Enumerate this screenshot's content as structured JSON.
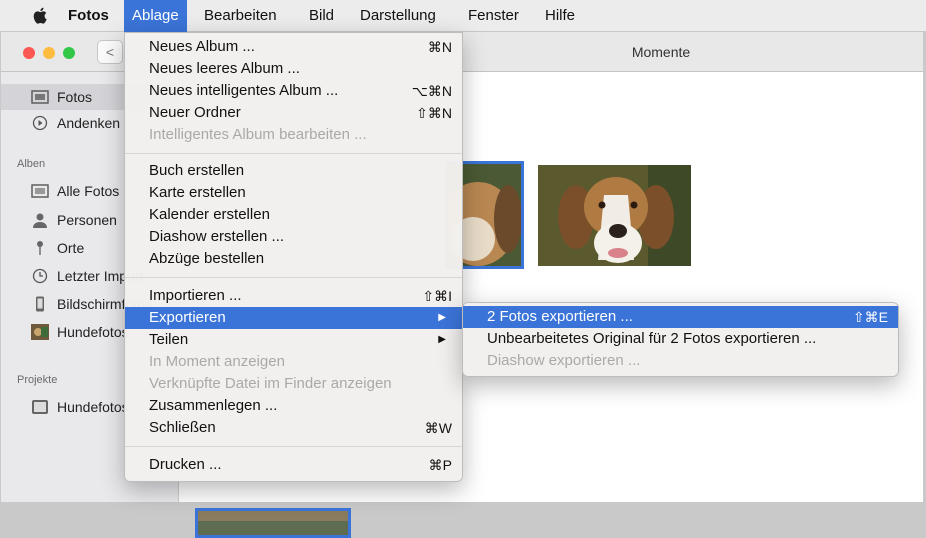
{
  "menubar": {
    "app": "Fotos",
    "items": [
      "Ablage",
      "Bearbeiten",
      "Bild",
      "Darstellung",
      "Fenster",
      "Hilfe"
    ]
  },
  "window": {
    "title": "Momente",
    "back": "<"
  },
  "sidebar": {
    "top": [
      "Fotos",
      "Andenken"
    ],
    "albums_header": "Alben",
    "albums": [
      "Alle Fotos",
      "Personen",
      "Orte",
      "Letzter Import",
      "Bildschirmfotos",
      "Hundefotos"
    ],
    "projects_header": "Projekte",
    "projects": [
      "Hundefotos"
    ]
  },
  "menu": {
    "rows": [
      {
        "label": "Neues Album ...",
        "shortcut": "⌘N",
        "enabled": true
      },
      {
        "label": "Neues leeres Album ...",
        "shortcut": "",
        "enabled": true
      },
      {
        "label": "Neues intelligentes Album ...",
        "shortcut": "⌥⌘N",
        "enabled": true
      },
      {
        "label": "Neuer Ordner",
        "shortcut": "⇧⌘N",
        "enabled": true
      },
      {
        "label": "Intelligentes Album bearbeiten ...",
        "shortcut": "",
        "enabled": false
      },
      {
        "label": "Buch erstellen",
        "shortcut": "",
        "enabled": true
      },
      {
        "label": "Karte erstellen",
        "shortcut": "",
        "enabled": true
      },
      {
        "label": "Kalender erstellen",
        "shortcut": "",
        "enabled": true
      },
      {
        "label": "Diashow erstellen ...",
        "shortcut": "",
        "enabled": true
      },
      {
        "label": "Abzüge bestellen",
        "shortcut": "",
        "enabled": true
      },
      {
        "label": "Importieren ...",
        "shortcut": "⇧⌘I",
        "enabled": true
      },
      {
        "label": "Exportieren",
        "shortcut": "",
        "enabled": true
      },
      {
        "label": "Teilen",
        "shortcut": "",
        "enabled": true
      },
      {
        "label": "In Moment anzeigen",
        "shortcut": "",
        "enabled": false
      },
      {
        "label": "Verknüpfte Datei im Finder anzeigen",
        "shortcut": "",
        "enabled": false
      },
      {
        "label": "Zusammenlegen ...",
        "shortcut": "",
        "enabled": true
      },
      {
        "label": "Schließen",
        "shortcut": "⌘W",
        "enabled": true
      },
      {
        "label": "Drucken ...",
        "shortcut": "⌘P",
        "enabled": true
      }
    ]
  },
  "submenu": {
    "rows": [
      {
        "label": "2 Fotos exportieren ...",
        "shortcut": "⇧⌘E",
        "enabled": true
      },
      {
        "label": "Unbearbeitetes Original für 2 Fotos exportieren ...",
        "shortcut": "",
        "enabled": true
      },
      {
        "label": "Diashow exportieren ...",
        "shortcut": "",
        "enabled": false
      }
    ]
  },
  "colors": {
    "accent": "#3b74d8",
    "disabled": "#a9a9a9"
  },
  "icons": [
    "apple-icon",
    "photos-icon",
    "memories-icon",
    "album-icon",
    "person-icon",
    "pin-icon",
    "clock-icon",
    "phone-icon",
    "project-icon",
    "submenu-arrow-icon"
  ]
}
